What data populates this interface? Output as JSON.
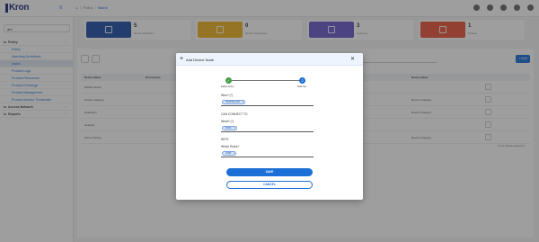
{
  "app": {
    "logo_text": "Kron"
  },
  "breadcrumb": {
    "items": [
      "Policy",
      "Matrix"
    ]
  },
  "sidebar": {
    "search_value": "ani",
    "items": [
      {
        "label": "Policy",
        "type": "group"
      },
      {
        "label": "Policy",
        "type": "sub"
      },
      {
        "label": "Matching Definitions",
        "type": "sub"
      },
      {
        "label": "Matrix",
        "type": "sub",
        "active": true
      },
      {
        "label": "Product Logs",
        "type": "sub"
      },
      {
        "label": "Product Resources",
        "type": "sub"
      },
      {
        "label": "Product Exchange",
        "type": "sub"
      },
      {
        "label": "Product Management",
        "type": "sub"
      },
      {
        "label": "Product Monitor Thresholds",
        "type": "sub"
      },
      {
        "label": "Access Network",
        "type": "group"
      },
      {
        "label": "Reports",
        "type": "group"
      }
    ]
  },
  "cards": [
    {
      "value": "5",
      "label": "Device Definition",
      "color": "#1e4fa8"
    },
    {
      "value": "0",
      "label": "Device Categories",
      "color": "#f0b323"
    },
    {
      "value": "3",
      "label": "Category",
      "color": "#6a5acd"
    },
    {
      "value": "1",
      "label": "Ruleset",
      "color": "#e8543b"
    }
  ],
  "table": {
    "add_label": "+ Add",
    "headers": [
      "Device Name",
      "Description",
      "Device Name"
    ],
    "rows": [
      [
        "Mobile Device",
        "",
        ""
      ],
      [
        "Device Category",
        "",
        "Device Category"
      ],
      [
        "Ruleset(s)",
        "",
        "Device Category"
      ],
      [
        "Network",
        "",
        ""
      ],
      [
        "Server Device",
        "",
        "Device Category"
      ]
    ],
    "pager": "1-5 of Showing Record"
  },
  "modal": {
    "title": "Add Device Node",
    "close_glyph": "✕",
    "steps": [
      {
        "label": "Define Entry",
        "state": "done",
        "glyph": "✓"
      },
      {
        "label": "Rule Set",
        "state": "current",
        "glyph": "2"
      }
    ],
    "who_label": "Who? (*)",
    "who_chip": "TEST001.ENT",
    "can_connect_label": "CAN CONNECT TO",
    "what_label": "What? (*)",
    "what_chip": "DNS1",
    "with_label": "WITH",
    "which_label": "Which Rules?",
    "which_chip": "ICMP",
    "save_label": "SAVE",
    "cancel_label": "CANCEL"
  }
}
